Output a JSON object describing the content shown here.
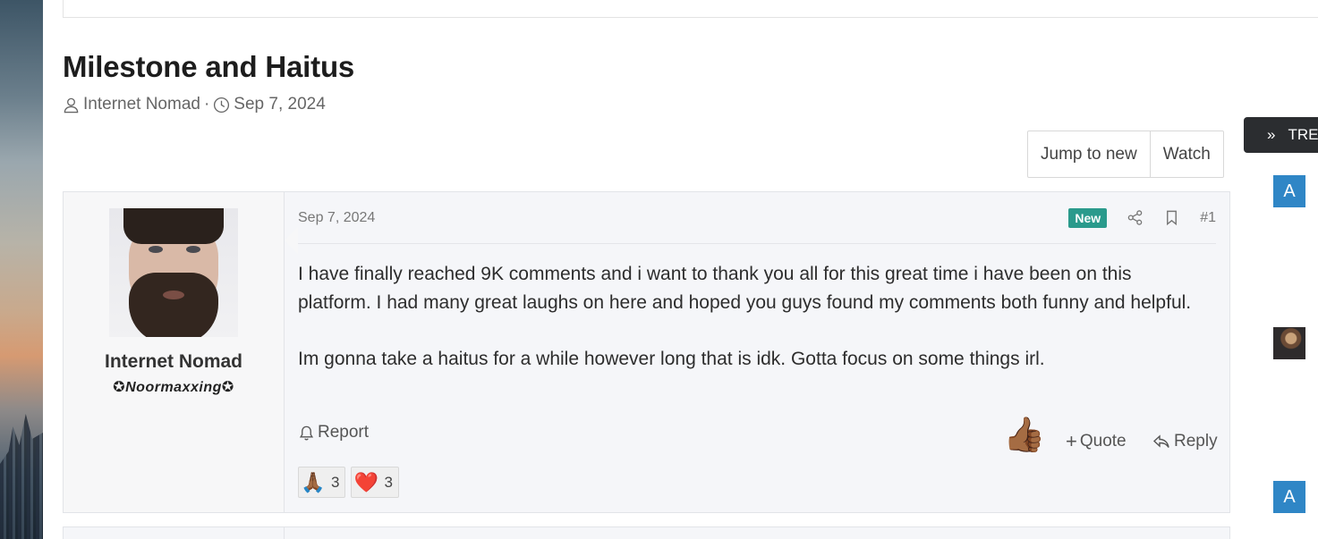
{
  "thread": {
    "title": "Milestone and Haitus",
    "author": "Internet Nomad",
    "separator": "·",
    "date": "Sep 7, 2024"
  },
  "buttons": {
    "jump_to_new": "Jump to new",
    "watch": "Watch"
  },
  "sidebar": {
    "trending_label": "TRE",
    "avatar_letter_1": "A",
    "avatar_letter_2": "A"
  },
  "post": {
    "date": "Sep 7, 2024",
    "badge": "New",
    "number": "#1",
    "user": {
      "name": "Internet Nomad",
      "title": "✪Noormaxxing✪"
    },
    "body": [
      "I have finally reached 9K comments and i want to thank you all for this great time i have been on this platform. I had many great laughs on here and hoped you guys found my comments both funny and helpful.",
      "Im gonna take a haitus for a while however long that is idk. Gotta focus on some things irl."
    ],
    "actions": {
      "report": "Report",
      "quote": "Quote",
      "reply": "Reply",
      "reaction_emoji": "👍🏾"
    },
    "reactions": [
      {
        "emoji": "🙏🏾",
        "count": "3"
      },
      {
        "emoji": "❤️",
        "count": "3"
      }
    ]
  },
  "colors": {
    "badge_new": "#2a9a8c",
    "sidebar_avatar": "#2f86c6",
    "trending_bg": "#2b2d30"
  }
}
